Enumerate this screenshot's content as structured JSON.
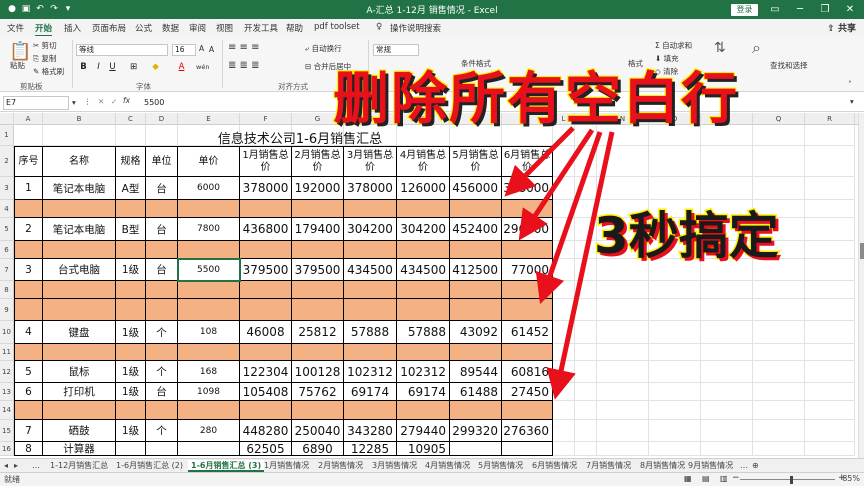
{
  "window": {
    "title": "A-汇总 1-12月 销售情况 - Excel",
    "login_label": "登录",
    "controls": [
      "▭",
      "─",
      "❐",
      "✕"
    ]
  },
  "ribbon_tabs": [
    "文件",
    "开始",
    "插入",
    "页面布局",
    "公式",
    "数据",
    "审阅",
    "视图",
    "开发工具",
    "帮助",
    "pdf toolset"
  ],
  "tell_me": "操作说明搜索",
  "share_label": "共享",
  "ribbon": {
    "clipboard": {
      "paste": "粘贴",
      "cut": "剪切",
      "copy": "复制",
      "format_painter": "格式刷",
      "label": "剪贴板"
    },
    "font": {
      "name": "等线",
      "size": "16",
      "label": "字体",
      "bold": "B",
      "italic": "I",
      "underline": "U",
      "wen": "wén"
    },
    "alignment": {
      "wrap": "自动换行",
      "merge": "合并后居中",
      "label": "对齐方式"
    },
    "number": {
      "format": "常规"
    },
    "cells": {
      "format": "格式"
    },
    "editing": {
      "autosum": "自动求和",
      "fill": "填充",
      "clear": "清除",
      "sort": "排序和筛选",
      "find": "查找和选择"
    },
    "styles": {
      "cond": "条件格式"
    }
  },
  "formula_bar": {
    "name_box": "E7",
    "fx": "fx",
    "value": "5500"
  },
  "columns": [
    "A",
    "B",
    "C",
    "D",
    "E",
    "F",
    "G",
    "H",
    "I",
    "J",
    "K",
    "L",
    "M",
    "N",
    "O",
    "P",
    "Q",
    "R"
  ],
  "sheet": {
    "title": "信息技术公司1-6月销售汇总",
    "headers": [
      "序号",
      "名称",
      "规格",
      "单位",
      "单价",
      "1月销售总价",
      "2月销售总价",
      "3月销售总价",
      "4月销售总价",
      "5月销售总价",
      "6月销售总价"
    ],
    "rows": [
      {
        "row": "3",
        "cells": [
          "1",
          "笔记本电脑",
          "A型",
          "台",
          "6000",
          "378000",
          "192000",
          "378000",
          "126000",
          "456000",
          "348000"
        ]
      },
      {
        "row": "5",
        "cells": [
          "2",
          "笔记本电脑",
          "B型",
          "台",
          "7800",
          "436800",
          "179400",
          "304200",
          "304200",
          "452400",
          "296400"
        ]
      },
      {
        "row": "7",
        "cells": [
          "3",
          "台式电脑",
          "1级",
          "台",
          "5500",
          "379500",
          "379500",
          "434500",
          "434500",
          "412500",
          "77000"
        ]
      },
      {
        "row": "10",
        "cells": [
          "4",
          "键盘",
          "1级",
          "个",
          "108",
          "46008",
          "25812",
          "57888",
          "57888",
          "43092",
          "61452"
        ]
      },
      {
        "row": "12",
        "cells": [
          "5",
          "鼠标",
          "1级",
          "个",
          "168",
          "122304",
          "100128",
          "102312",
          "102312",
          "89544",
          "60816"
        ]
      },
      {
        "row": "13",
        "cells": [
          "6",
          "打印机",
          "1级",
          "台",
          "1098",
          "105408",
          "75762",
          "69174",
          "69174",
          "61488",
          "27450"
        ]
      },
      {
        "row": "15",
        "cells": [
          "7",
          "硒鼓",
          "1级",
          "个",
          "280",
          "448280",
          "250040",
          "343280",
          "279440",
          "299320",
          "276360"
        ]
      },
      {
        "row": "16",
        "cells": [
          "8",
          "计算器",
          "",
          "",
          "",
          "62505",
          "6890",
          "12285",
          "10905",
          "",
          ""
        ]
      }
    ],
    "row_numbers": [
      "1",
      "2",
      "3",
      "4",
      "5",
      "6",
      "7",
      "8",
      "9",
      "10",
      "11",
      "12",
      "13",
      "14",
      "15",
      "16"
    ]
  },
  "sheet_tabs": [
    "1-12月销售汇总",
    "1-6月销售汇总 (2)",
    "1-6月销售汇总 (3)",
    "1月销售情况",
    "2月销售情况",
    "3月销售情况",
    "4月销售情况",
    "5月销售情况",
    "6月销售情况",
    "7月销售情况",
    "8月销售情况",
    "9月销售情况"
  ],
  "active_sheet_tab": 2,
  "status": {
    "ready": "就绪",
    "zoom": "85%"
  },
  "overlay": {
    "main": "删除所有空白行",
    "sub": "3秒搞定"
  },
  "colors": {
    "brand": "#217346",
    "blank_row": "#f4b183",
    "overlay_red": "#e8101a",
    "overlay_yellow": "#fff200"
  }
}
